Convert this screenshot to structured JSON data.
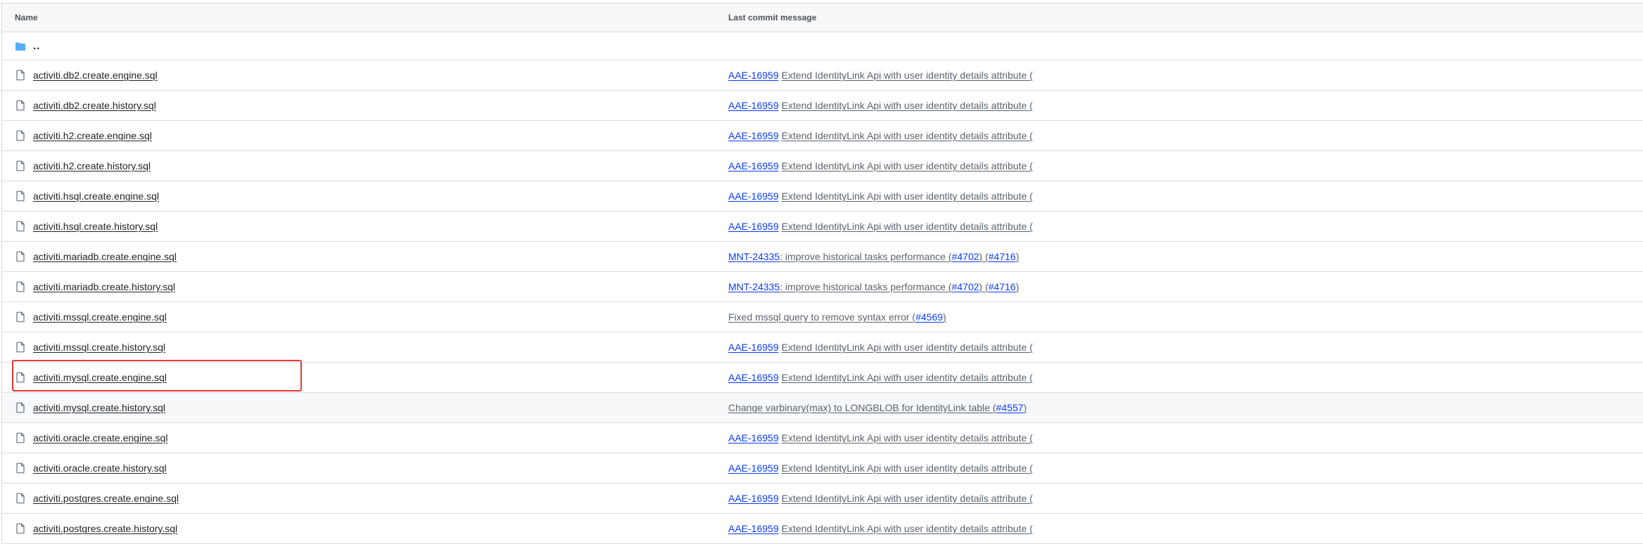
{
  "header": {
    "name_label": "Name",
    "message_label": "Last commit message"
  },
  "parent_dir": {
    "label": ".."
  },
  "icons": {
    "folder": "folder-icon",
    "file": "file-icon"
  },
  "colors": {
    "link_blue": "#0b3cf5",
    "highlight_red": "#e53935",
    "folder_blue": "#54aeff"
  },
  "files": [
    {
      "name": "activiti.db2.create.engine.sql",
      "ticket": "AAE-16959",
      "msg": "Extend IdentityLink Api with user identity details attribute (",
      "pr_prefix": "",
      "pr1": "",
      "between": "",
      "pr2": "",
      "suffix": ""
    },
    {
      "name": "activiti.db2.create.history.sql",
      "ticket": "AAE-16959",
      "msg": "Extend IdentityLink Api with user identity details attribute (",
      "pr_prefix": "",
      "pr1": "",
      "between": "",
      "pr2": "",
      "suffix": ""
    },
    {
      "name": "activiti.h2.create.engine.sql",
      "ticket": "AAE-16959",
      "msg": "Extend IdentityLink Api with user identity details attribute (",
      "pr_prefix": "",
      "pr1": "",
      "between": "",
      "pr2": "",
      "suffix": ""
    },
    {
      "name": "activiti.h2.create.history.sql",
      "ticket": "AAE-16959",
      "msg": "Extend IdentityLink Api with user identity details attribute (",
      "pr_prefix": "",
      "pr1": "",
      "between": "",
      "pr2": "",
      "suffix": ""
    },
    {
      "name": "activiti.hsql.create.engine.sql",
      "ticket": "AAE-16959",
      "msg": "Extend IdentityLink Api with user identity details attribute (",
      "pr_prefix": "",
      "pr1": "",
      "between": "",
      "pr2": "",
      "suffix": ""
    },
    {
      "name": "activiti.hsql.create.history.sql",
      "ticket": "AAE-16959",
      "msg": "Extend IdentityLink Api with user identity details attribute (",
      "pr_prefix": "",
      "pr1": "",
      "between": "",
      "pr2": "",
      "suffix": ""
    },
    {
      "name": "activiti.mariadb.create.engine.sql",
      "ticket": "MNT-24335",
      "msg": ": improve historical tasks performance (",
      "pr_prefix": "",
      "pr1": "#4702",
      "between": ") (",
      "pr2": "#4716",
      "suffix": ")"
    },
    {
      "name": "activiti.mariadb.create.history.sql",
      "ticket": "MNT-24335",
      "msg": ": improve historical tasks performance (",
      "pr_prefix": "",
      "pr1": "#4702",
      "between": ") (",
      "pr2": "#4716",
      "suffix": ")"
    },
    {
      "name": "activiti.mssql.create.engine.sql",
      "ticket": "",
      "msg": "Fixed mssql query to remove syntax error (",
      "pr_prefix": "",
      "pr1": "#4569",
      "between": ")",
      "pr2": "",
      "suffix": ""
    },
    {
      "name": "activiti.mssql.create.history.sql",
      "ticket": "AAE-16959",
      "msg": "Extend IdentityLink Api with user identity details attribute (",
      "pr_prefix": "",
      "pr1": "",
      "between": "",
      "pr2": "",
      "suffix": ""
    },
    {
      "name": "activiti.mysql.create.engine.sql",
      "ticket": "AAE-16959",
      "msg": "Extend IdentityLink Api with user identity details attribute (",
      "pr_prefix": "",
      "pr1": "",
      "between": "",
      "pr2": "",
      "suffix": ""
    },
    {
      "name": "activiti.mysql.create.history.sql",
      "ticket": "",
      "msg": "Change varbinary(max) to LONGBLOB for IdentityLink table (",
      "pr_prefix": "",
      "pr1": "#4557",
      "between": ")",
      "pr2": "",
      "suffix": ""
    },
    {
      "name": "activiti.oracle.create.engine.sql",
      "ticket": "AAE-16959",
      "msg": "Extend IdentityLink Api with user identity details attribute (",
      "pr_prefix": "",
      "pr1": "",
      "between": "",
      "pr2": "",
      "suffix": ""
    },
    {
      "name": "activiti.oracle.create.history.sql",
      "ticket": "AAE-16959",
      "msg": "Extend IdentityLink Api with user identity details attribute (",
      "pr_prefix": "",
      "pr1": "",
      "between": "",
      "pr2": "",
      "suffix": ""
    },
    {
      "name": "activiti.postgres.create.engine.sql",
      "ticket": "AAE-16959",
      "msg": "Extend IdentityLink Api with user identity details attribute (",
      "pr_prefix": "",
      "pr1": "",
      "between": "",
      "pr2": "",
      "suffix": ""
    },
    {
      "name": "activiti.postgres.create.history.sql",
      "ticket": "AAE-16959",
      "msg": "Extend IdentityLink Api with user identity details attribute (",
      "pr_prefix": "",
      "pr1": "",
      "between": "",
      "pr2": "",
      "suffix": ""
    }
  ]
}
